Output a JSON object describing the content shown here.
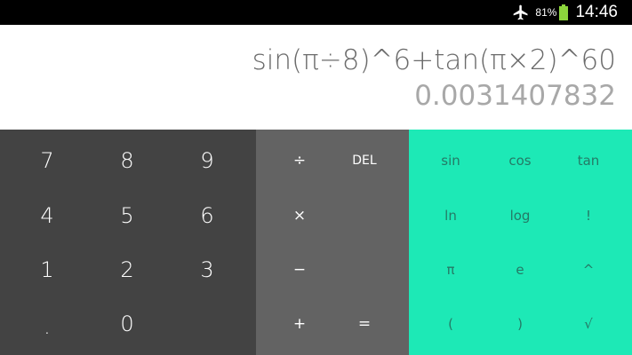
{
  "status_bar": {
    "airplane_icon": "airplane-mode-icon",
    "battery_percent": "81%",
    "battery_icon": "battery-icon",
    "battery_color": "#8cd63c",
    "time": "14:46"
  },
  "display": {
    "formula": "sin(π÷8)^6+tan(π×2)^60",
    "result": "0.0031407832"
  },
  "keypad": {
    "numbers": [
      "7",
      "8",
      "9",
      "4",
      "5",
      "6",
      "1",
      "2",
      "3",
      ".",
      "0"
    ],
    "operators": {
      "divide": "÷",
      "delete": "DEL",
      "multiply": "×",
      "minus": "−",
      "plus": "+",
      "equals": "="
    },
    "advanced": [
      "sin",
      "cos",
      "tan",
      "ln",
      "log",
      "!",
      "π",
      "e",
      "^",
      "(",
      ")",
      "√"
    ]
  },
  "colors": {
    "numbers_pad": "#434343",
    "operators_pad": "#636363",
    "advanced_pad": "#1de9b6",
    "advanced_text": "#257a66",
    "formula_text": "#6b6b6b",
    "result_text": "#a8a8a8"
  }
}
